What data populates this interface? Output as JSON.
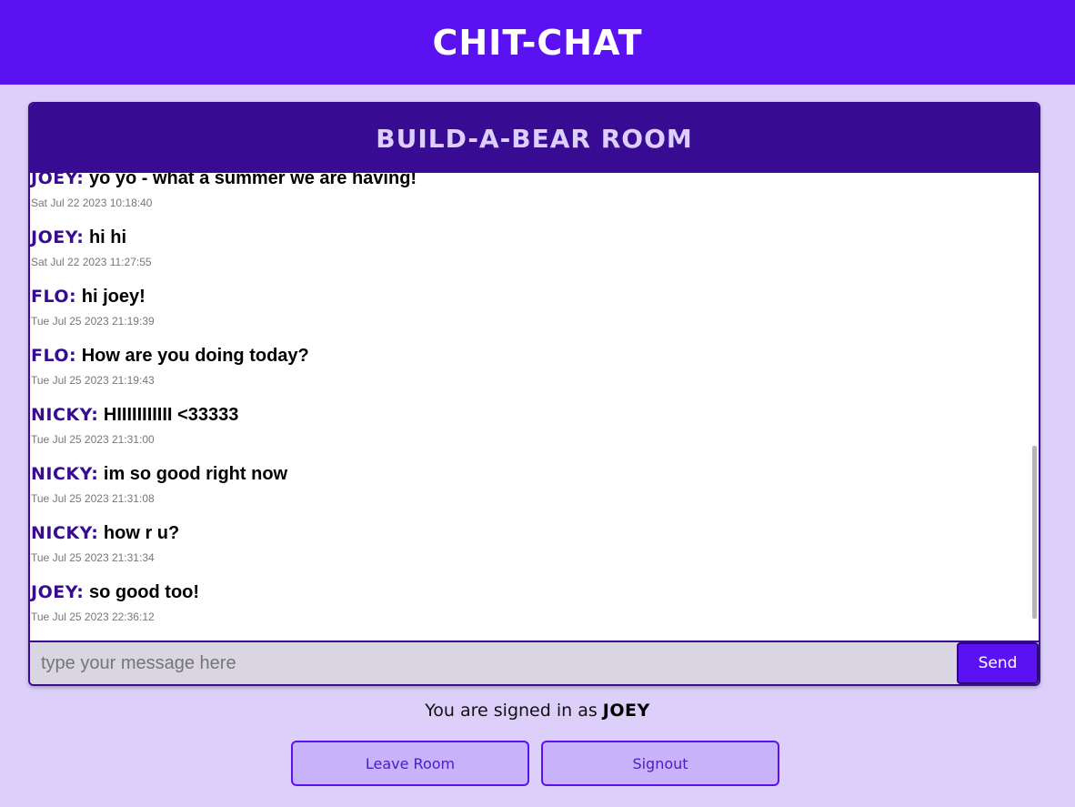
{
  "app": {
    "title": "CHIT-CHAT"
  },
  "room": {
    "title": "BUILD-A-BEAR ROOM"
  },
  "messages": [
    {
      "user": "JOEY:",
      "text": "yo yo - what a summer we are having!",
      "time": "Sat Jul 22 2023 10:18:40"
    },
    {
      "user": "JOEY:",
      "text": "hi hi",
      "time": "Sat Jul 22 2023 11:27:55"
    },
    {
      "user": "FLO:",
      "text": "hi joey!",
      "time": "Tue Jul 25 2023 21:19:39"
    },
    {
      "user": "FLO:",
      "text": "How are you doing today?",
      "time": "Tue Jul 25 2023 21:19:43"
    },
    {
      "user": "NICKY:",
      "text": "HIIIIIIIIIII <33333",
      "time": "Tue Jul 25 2023 21:31:00"
    },
    {
      "user": "NICKY:",
      "text": "im so good right now",
      "time": "Tue Jul 25 2023 21:31:08"
    },
    {
      "user": "NICKY:",
      "text": "how r u?",
      "time": "Tue Jul 25 2023 21:31:34"
    },
    {
      "user": "JOEY:",
      "text": "so good too!",
      "time": "Tue Jul 25 2023 22:36:12"
    }
  ],
  "composer": {
    "placeholder": "type your message here",
    "value": "",
    "send_label": "Send"
  },
  "footer": {
    "signed_in_prefix": "You are signed in as",
    "signed_in_user": "JOEY",
    "leave_label": "Leave Room",
    "signout_label": "Signout"
  },
  "colors": {
    "topbar": "#5b12f3",
    "room_header": "#370c92",
    "background": "#dcd0fb",
    "button_fill": "#c8b3fb"
  }
}
